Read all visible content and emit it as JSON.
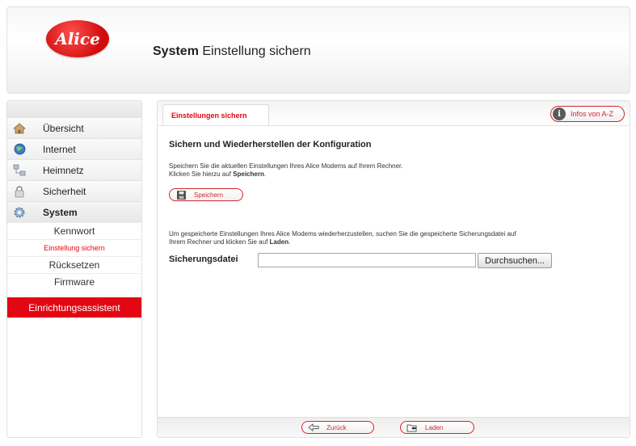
{
  "brand": {
    "logo_text": "Alice",
    "accent_color": "#e30613"
  },
  "header": {
    "title_bold": "System",
    "title_rest": " Einstellung sichern"
  },
  "sidebar": {
    "items": [
      {
        "label": "Übersicht",
        "icon": "house-icon"
      },
      {
        "label": "Internet",
        "icon": "globe-icon"
      },
      {
        "label": "Heimnetz",
        "icon": "network-icon"
      },
      {
        "label": "Sicherheit",
        "icon": "lock-icon"
      },
      {
        "label": "System",
        "icon": "gear-icon"
      }
    ],
    "subitems": [
      {
        "label": "Kennwort"
      },
      {
        "label": "Einstellung sichern"
      },
      {
        "label": "Rücksetzen"
      },
      {
        "label": "Firmware"
      }
    ],
    "assistant_label": "Einrichtungsassistent"
  },
  "main": {
    "tab_label": "Einstellungen sichern",
    "info_label": "Infos von A-Z",
    "section_title": "Sichern und Wiederherstellen der Konfiguration",
    "save_desc_line1": "Speichern Sie die aktuellen Einstellungen Ihres Alice Modems auf Ihrem Rechner.",
    "save_desc_line2_pre": "Klicken Sie hierzu auf ",
    "save_desc_line2_bold": "Speichern",
    "save_desc_line2_post": ".",
    "save_button": "Speichern",
    "restore_desc_line1": "Um gespeicherte Einstellungen Ihres Alice Modems wiederherzustellen, suchen Sie die gespeicherte Sicherungsdatei auf",
    "restore_desc_line2_pre": "Ihrem Rechner und klicken Sie auf ",
    "restore_desc_line2_bold": "Laden",
    "restore_desc_line2_post": ".",
    "file_label": "Sicherungsdatei",
    "file_value": "",
    "browse_button": "Durchsuchen...",
    "back_button": "Zurück",
    "load_button": "Laden"
  }
}
